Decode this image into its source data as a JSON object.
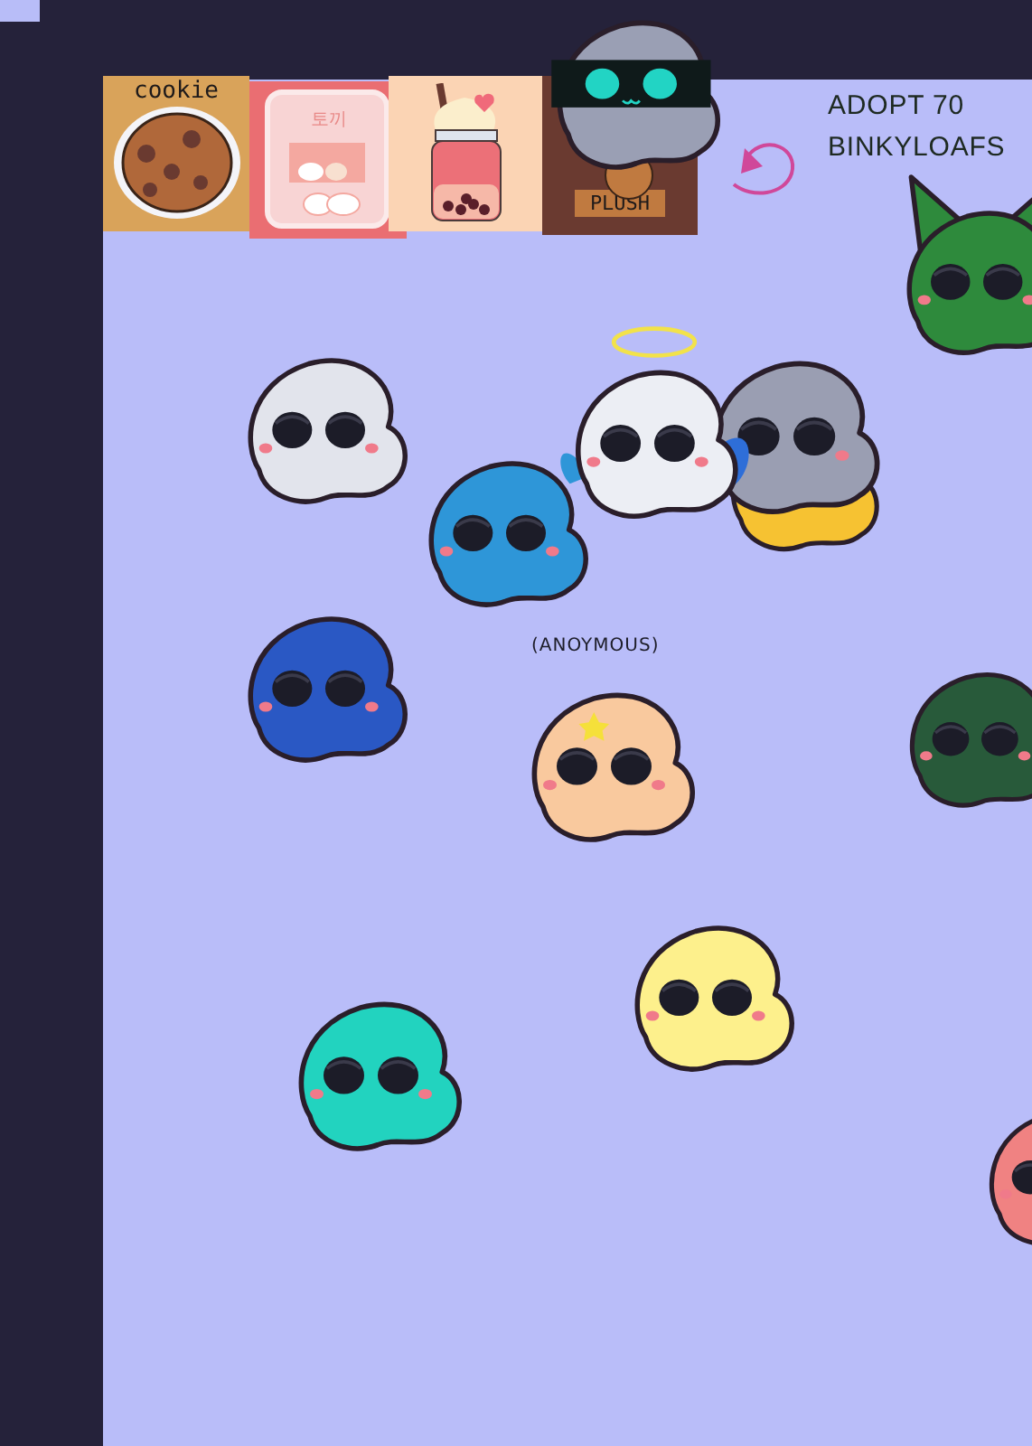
{
  "stickers": [
    {
      "kind": "cookie",
      "label": "cookie"
    },
    {
      "kind": "milk",
      "label": "토끼"
    },
    {
      "kind": "jar"
    },
    {
      "kind": "plush",
      "label": "PLUSH"
    }
  ],
  "title_lines": [
    "ADOPT 70",
    "BINKYLOAFS"
  ],
  "creatures": [
    {
      "kind": "visor",
      "color": "#9a9fb4"
    },
    {
      "kind": "cat",
      "color": "#2e8a3c"
    },
    {
      "kind": "plain",
      "color": "#e2e4ec"
    },
    {
      "kind": "plain",
      "color": "#f6c232"
    },
    {
      "kind": "halo",
      "color": "#eceef4"
    },
    {
      "kind": "plain",
      "color": "#9a9eb2"
    },
    {
      "kind": "plain",
      "color": "#2e96d8"
    },
    {
      "kind": "plain",
      "color": "#2a58c4"
    },
    {
      "kind": "star",
      "color": "#f9c99e",
      "label": "(ANOYMOUS)"
    },
    {
      "kind": "plain",
      "color": "#285a3a"
    },
    {
      "kind": "plain",
      "color": "#fdf08c"
    },
    {
      "kind": "plain",
      "color": "#22d3bf"
    },
    {
      "kind": "plain",
      "color": "#f08282"
    }
  ]
}
